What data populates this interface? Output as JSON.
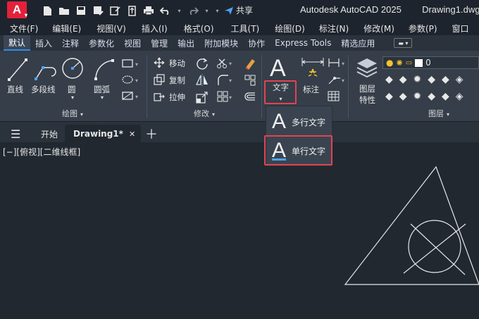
{
  "titlebar": {
    "logo_letter": "A",
    "share_label": "共享",
    "app_title": "Autodesk AutoCAD 2025",
    "doc_title": "Drawing1.dwg"
  },
  "menubar": {
    "items": [
      "文件(F)",
      "编辑(E)",
      "视图(V)",
      "插入(I)",
      "格式(O)",
      "工具(T)",
      "绘图(D)",
      "标注(N)",
      "修改(M)",
      "参数(P)",
      "窗口"
    ]
  },
  "ribbon_tabs": {
    "items": [
      "默认",
      "插入",
      "注释",
      "参数化",
      "视图",
      "管理",
      "输出",
      "附加模块",
      "协作",
      "Express Tools",
      "精选应用"
    ],
    "active_index": 0
  },
  "draw_panel": {
    "title": "绘图",
    "tools": [
      "直线",
      "多段线",
      "圆",
      "圆弧"
    ]
  },
  "modify_panel": {
    "title": "修改",
    "tools": [
      "移动",
      "复制",
      "拉伸"
    ]
  },
  "annotation_panel": {
    "text_label": "文字",
    "dim_label": "标注"
  },
  "layers_panel": {
    "title": "图层",
    "tool1": "图层",
    "tool2": "特性",
    "layer_value": "0"
  },
  "filetabs": {
    "start_label": "开始",
    "drawing_label": "Drawing1*"
  },
  "viewport": {
    "label": "[−][俯视][二维线框]"
  },
  "text_dropdown": {
    "items": [
      "多行文字",
      "单行文字"
    ],
    "highlighted": "单行文字"
  },
  "colors": {
    "accent_red": "#e04450",
    "tab_underline": "#2a8cf0",
    "canvas": "#212830"
  }
}
